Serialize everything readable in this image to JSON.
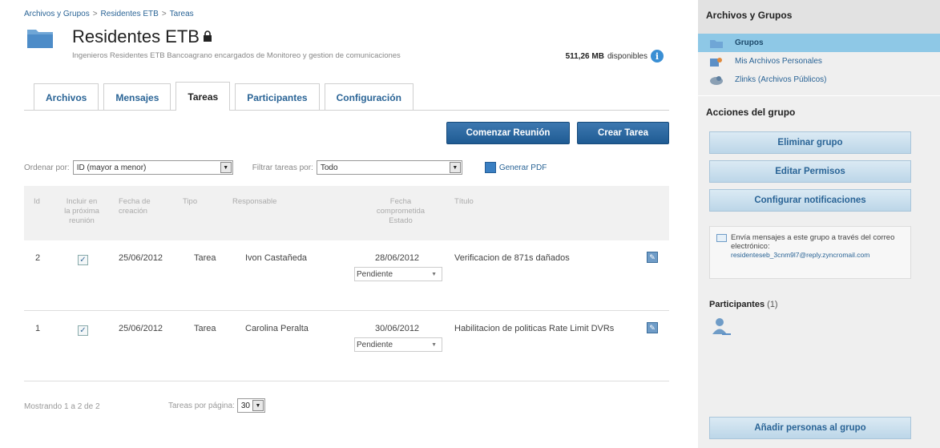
{
  "breadcrumb": [
    "Archivos y Grupos",
    "Residentes ETB",
    "Tareas"
  ],
  "breadcrumb_separator": ">",
  "group": {
    "title": "Residentes ETB",
    "description": "Ingenieros Residentes ETB Bancoagrano encargados de Monitoreo y gestion de comunicaciones",
    "space_value": "511,26 MB",
    "space_label": "disponibles"
  },
  "tabs": [
    {
      "label": "Archivos",
      "active": false
    },
    {
      "label": "Mensajes",
      "active": false
    },
    {
      "label": "Tareas",
      "active": true
    },
    {
      "label": "Participantes",
      "active": false
    },
    {
      "label": "Configuración",
      "active": false
    }
  ],
  "actions": {
    "start_meeting": "Comenzar Reunión",
    "create_task": "Crear Tarea"
  },
  "filters": {
    "order_label": "Ordenar por:",
    "order_value": "ID (mayor a menor)",
    "filter_label": "Filtrar tareas por:",
    "filter_value": "Todo",
    "pdf_label": "Generar PDF"
  },
  "table": {
    "headers": {
      "id": "Id",
      "include": [
        "Incluir en",
        "la próxima",
        "reunión"
      ],
      "created": [
        "Fecha de",
        "creación"
      ],
      "type": "Tipo",
      "owner": "Responsable",
      "due": [
        "Fecha",
        "comprometida",
        "Estado"
      ],
      "title": "Título"
    },
    "rows": [
      {
        "id": "2",
        "checked": "✓",
        "created": "25/06/2012",
        "type": "Tarea",
        "owner": "Ivon Castañeda",
        "due": "28/06/2012",
        "status": "Pendiente",
        "title": "Verificacion de 871s dañados"
      },
      {
        "id": "1",
        "checked": "✓",
        "created": "25/06/2012",
        "type": "Tarea",
        "owner": "Carolina Peralta",
        "due": "30/06/2012",
        "status": "Pendiente",
        "title": "Habilitacion de politicas Rate Limit DVRs"
      }
    ]
  },
  "footer": {
    "showing": "Mostrando 1 a 2 de 2",
    "per_page_label": "Tareas por página:",
    "per_page_value": "30"
  },
  "sidebar": {
    "title": "Archivos y Grupos",
    "items": [
      {
        "label": "Grupos",
        "active": true
      },
      {
        "label": "Mis Archivos Personales",
        "active": false
      },
      {
        "label": "Zlinks (Archivos Públicos)",
        "active": false
      }
    ],
    "actions_title": "Acciones del grupo",
    "buttons": [
      "Eliminar grupo",
      "Editar Permisos",
      "Configurar notificaciones"
    ],
    "email_text": "Envía mensajes a este grupo a través del correo electrónico:",
    "email_address": "residenteseb_3cnm9l7@reply.zyncromail.com",
    "participants_label": "Participantes",
    "participants_count": "(1)",
    "add_people": "Añadir personas al grupo"
  },
  "colors": {
    "link": "#2a6496",
    "primary_button": "#2b6aa3",
    "sidebar_active": "#8ec8e6",
    "sidebar_bg": "#efefef"
  }
}
